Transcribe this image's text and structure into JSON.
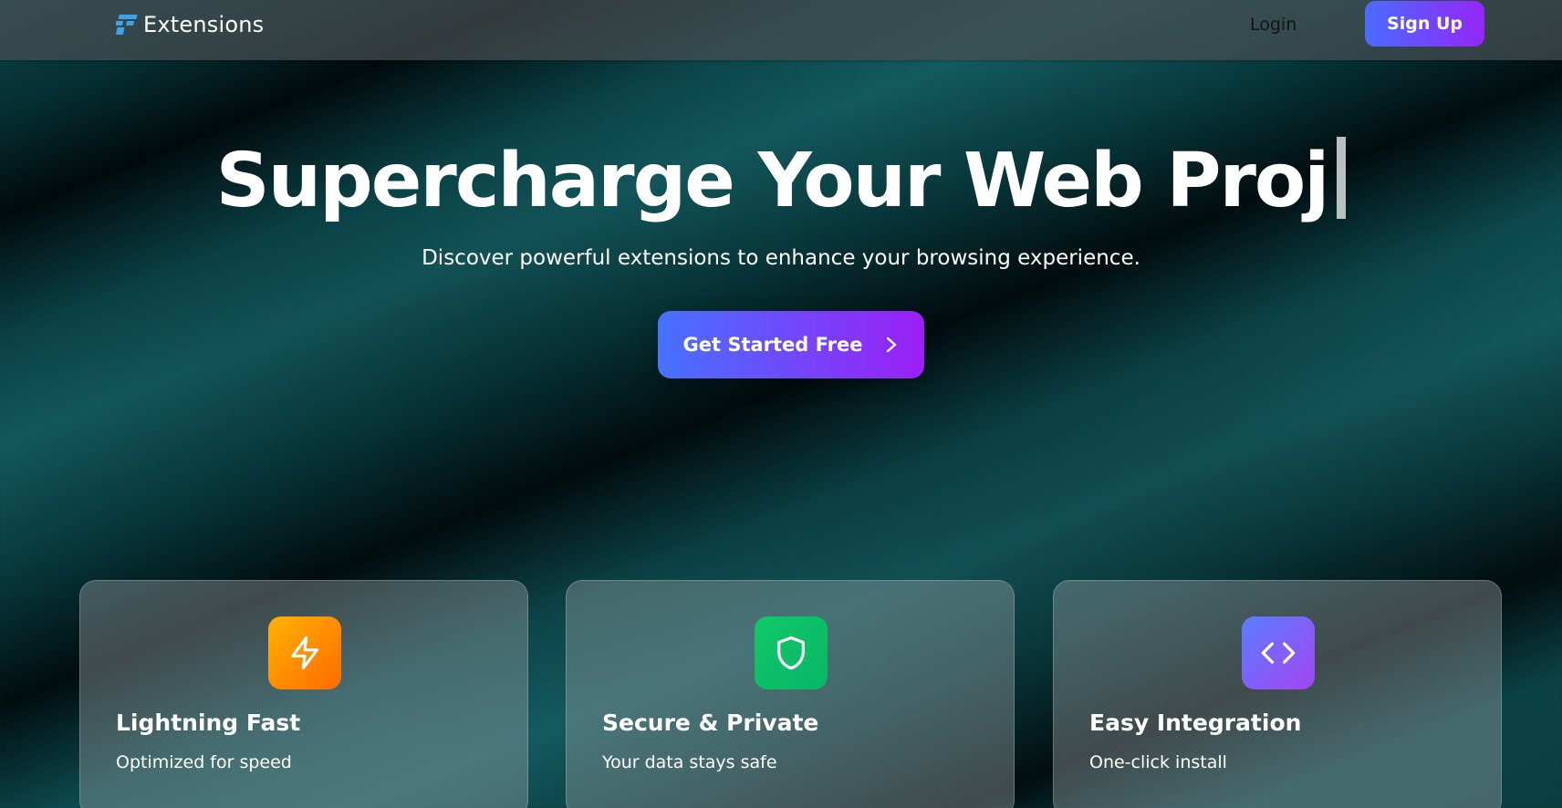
{
  "nav": {
    "brand_name": "Extensions",
    "login_label": "Login",
    "signup_label": "Sign Up"
  },
  "hero": {
    "title": "Supercharge Your Web Proj",
    "subtitle": "Discover powerful extensions to enhance your browsing experience.",
    "cta_label": "Get Started Free",
    "cta_icon": "chevron-right-icon"
  },
  "features": [
    {
      "icon": "lightning-icon",
      "title": "Lightning Fast",
      "description": "Optimized for speed"
    },
    {
      "icon": "shield-icon",
      "title": "Secure & Private",
      "description": "Your data stays safe"
    },
    {
      "icon": "code-icon",
      "title": "Easy Integration",
      "description": "One-click install"
    }
  ],
  "colors": {
    "accent_start": "#4a6cff",
    "accent_end": "#9426f7",
    "feature_1": "#ff9a00",
    "feature_2": "#0dc267",
    "feature_3": "#8558f8",
    "brand_icon": "#3fa3e8"
  }
}
